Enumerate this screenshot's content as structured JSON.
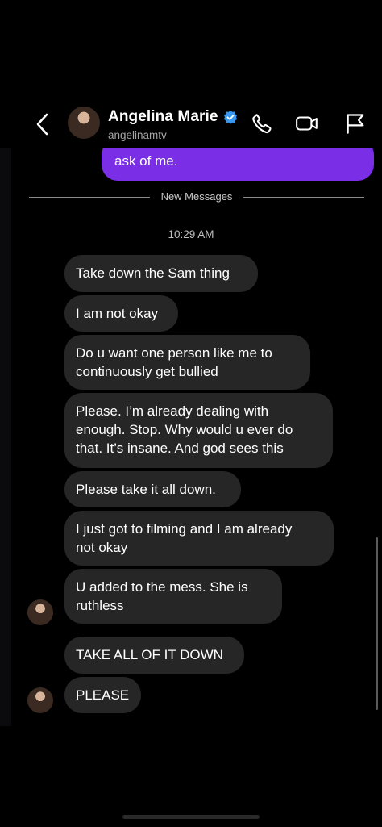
{
  "header": {
    "name": "Angelina Marie",
    "username": "angelinamtv",
    "verified": true,
    "back_icon": "chevron-left-icon",
    "phone_icon": "phone-icon",
    "video_icon": "video-camera-icon",
    "flag_icon": "flag-icon"
  },
  "outgoing_partial": {
    "text": "ask of me."
  },
  "divider": {
    "label": "New Messages"
  },
  "timestamp": "10:29 AM",
  "messages": [
    {
      "text": "Take down the Sam thing"
    },
    {
      "text": "I am not okay"
    },
    {
      "text": "Do u want one person like me to\ncontinuously get bullied"
    },
    {
      "text": "Please. I’m already dealing with\nenough. Stop. Why would u ever do\nthat. It’s insane. And god sees this"
    },
    {
      "text": "Please take it all down."
    },
    {
      "text": "I just got to filming and I am already\nnot okay"
    },
    {
      "text": "U added to the mess. She is\nruthless"
    },
    {
      "text": "TAKE ALL OF IT DOWN"
    },
    {
      "text": "PLEASE"
    }
  ],
  "colors": {
    "background": "#000000",
    "incoming_bubble": "#262626",
    "outgoing_bubble": "#7a2ee6",
    "verified_blue": "#3897f0"
  }
}
